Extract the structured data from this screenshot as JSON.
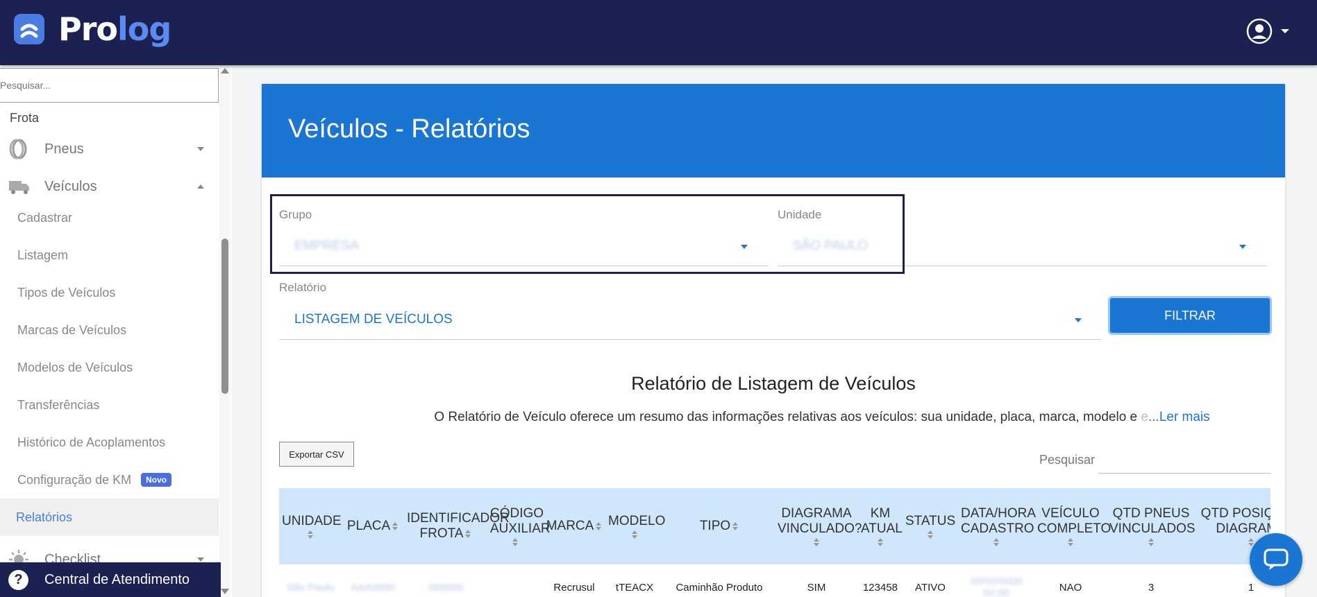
{
  "app": {
    "brand_part1": "Pro",
    "brand_part2": "log"
  },
  "sidebar": {
    "search_placeholder": "Pesquisar...",
    "section": "Frota",
    "groups": {
      "pneus": "Pneus",
      "veiculos": "Veículos",
      "checklist": "Checklist"
    },
    "items": [
      {
        "label": "Cadastrar"
      },
      {
        "label": "Listagem"
      },
      {
        "label": "Tipos de Veículos"
      },
      {
        "label": "Marcas de Veículos"
      },
      {
        "label": "Modelos de Veículos"
      },
      {
        "label": "Transferências"
      },
      {
        "label": "Histórico de Acoplamentos"
      },
      {
        "label": "Configuração de KM",
        "badge": "Novo"
      },
      {
        "label": "Relatórios",
        "active": true
      }
    ],
    "help": "Central de Atendimento"
  },
  "page": {
    "title": "Veículos - Relatórios",
    "filters": {
      "grupo_label": "Grupo",
      "grupo_value": "EMPRESA",
      "unidade_label": "Unidade",
      "unidade_value": "SÃO PAULO",
      "relatorio_label": "Relatório",
      "relatorio_value": "LISTAGEM DE VEÍCULOS",
      "button": "FILTRAR"
    },
    "report": {
      "title": "Relatório de Listagem de Veículos",
      "description": "O Relatório de Veículo oferece um resumo das informações relativas aos veículos: sua unidade, placa, marca, modelo e ",
      "description_fade": "e",
      "read_more": "...Ler mais"
    },
    "export_button": "Exportar CSV",
    "table_search_label": "Pesquisar",
    "table": {
      "headers": [
        "UNIDADE",
        "PLACA",
        "IDENTIFICADOR FROTA",
        "CÓDIGO AUXILIAR",
        "MARCA",
        "MODELO",
        "TIPO",
        "DIAGRAMA VINCULADO?",
        "KM ATUAL",
        "STATUS",
        "DATA/HORA CADASTRO",
        "VEÍCULO COMPLETO",
        "QTD PNEUS VINCULADOS",
        "QTD POSIÇÕES DIAGRAMA"
      ],
      "rows": [
        {
          "unidade": "São Paulo",
          "placa": "AAA0000",
          "identificador": "000000",
          "codigo": "",
          "marca": "Recrusul",
          "modelo": "tTEACX",
          "tipo": "Caminhão Produto",
          "diagrama": "SIM",
          "km": "123458",
          "status": "ATIVO",
          "data": "00/00/0000 00:00",
          "completo": "NAO",
          "qtd_pneus": "3",
          "qtd_posicoes": "1"
        }
      ]
    }
  },
  "colors": {
    "header_bg": "#1b2150",
    "accent": "#1a76d2",
    "brand_light": "#5b8af0",
    "table_header_bg": "#cfe6fb"
  }
}
